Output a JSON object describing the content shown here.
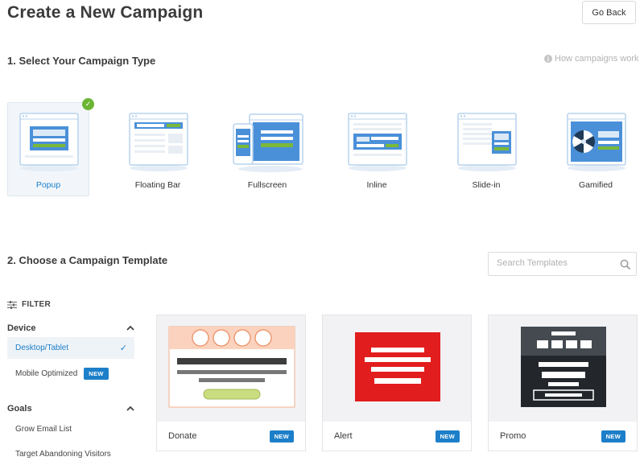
{
  "header": {
    "title": "Create a New Campaign",
    "go_back_label": "Go Back"
  },
  "step1": {
    "title": "1. Select Your Campaign Type",
    "help_link": "How campaigns work",
    "types": [
      {
        "label": "Popup",
        "selected": true
      },
      {
        "label": "Floating Bar",
        "selected": false
      },
      {
        "label": "Fullscreen",
        "selected": false
      },
      {
        "label": "Inline",
        "selected": false
      },
      {
        "label": "Slide-in",
        "selected": false
      },
      {
        "label": "Gamified",
        "selected": false
      }
    ]
  },
  "step2": {
    "title": "2. Choose a Campaign Template",
    "search": {
      "placeholder": "Search Templates"
    }
  },
  "filter": {
    "label": "FILTER",
    "device": {
      "title": "Device",
      "items": [
        {
          "label": "Desktop/Tablet",
          "active": true
        },
        {
          "label": "Mobile Optimized",
          "badge": "NEW"
        }
      ]
    },
    "goals": {
      "title": "Goals",
      "items": [
        {
          "label": "Grow Email List"
        },
        {
          "label": "Target Abandoning Visitors"
        }
      ]
    }
  },
  "templates": [
    {
      "name": "Donate",
      "badge": "NEW"
    },
    {
      "name": "Alert",
      "badge": "NEW"
    },
    {
      "name": "Promo",
      "badge": "NEW"
    }
  ],
  "colors": {
    "accent": "#1d7fc9",
    "check": "#6bb533",
    "popup_blue": "#4a90d9",
    "cta_green": "#7ab83a"
  }
}
